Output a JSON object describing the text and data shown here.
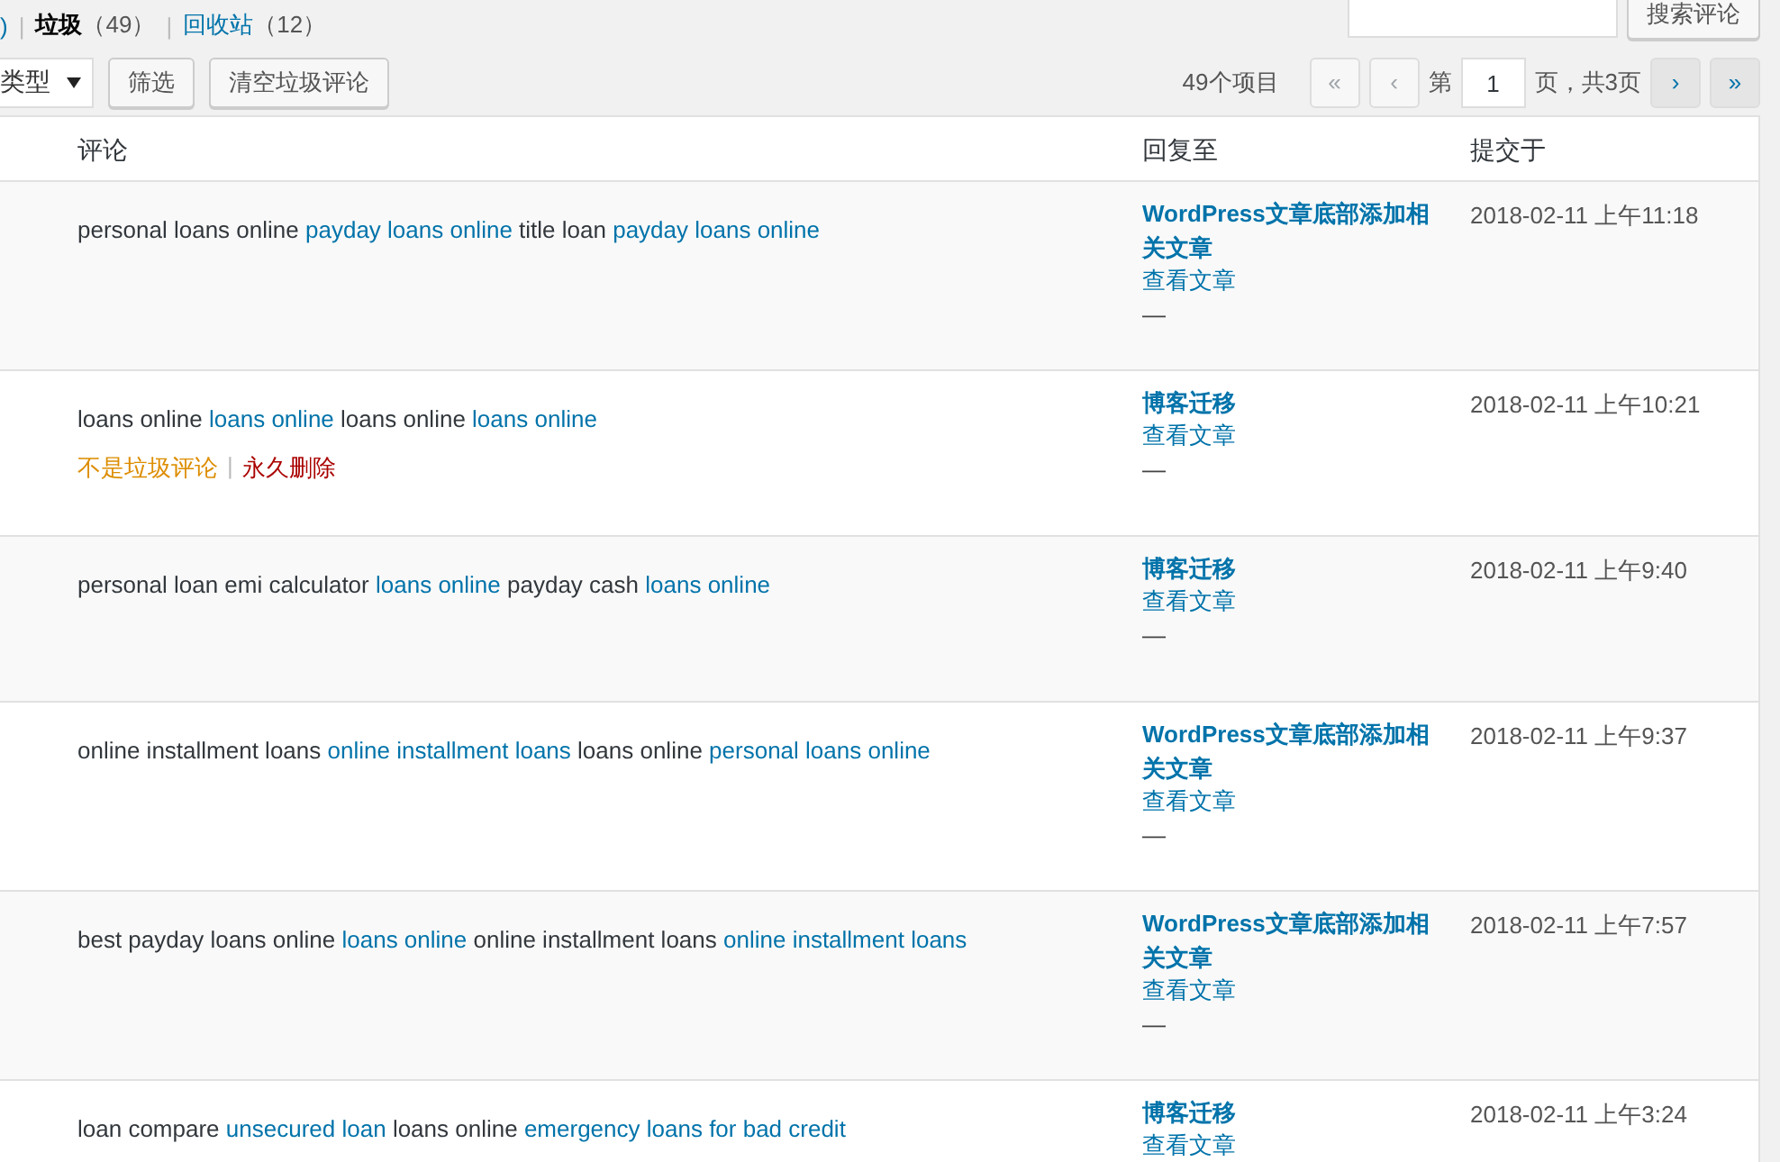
{
  "status_links": [
    {
      "label": ")",
      "selected": false
    },
    {
      "separator": "|",
      "label": "垃圾",
      "count": "（49）",
      "selected": true
    },
    {
      "separator": "|",
      "label": "回收站",
      "count": "（12）",
      "selected": false
    }
  ],
  "search": {
    "button": "搜索评论"
  },
  "filters": {
    "type_select": "类型",
    "filter_button": "筛选",
    "empty_button": "清空垃圾评论"
  },
  "pagination": {
    "count": "49个项目",
    "first": "«",
    "prev": "‹",
    "page_prefix": "第",
    "page": "1",
    "page_suffix": "页，共3页",
    "next": "›",
    "last": "»"
  },
  "table": {
    "columns": [
      "评论",
      "回复至",
      "提交于"
    ],
    "rows": [
      {
        "comment": [
          {
            "text": "personal loans online",
            "link": false
          },
          {
            "text": "payday loans online",
            "link": true
          },
          {
            "text": "title loan",
            "link": false
          },
          {
            "text": "payday loans online",
            "link": true
          }
        ],
        "actions": [],
        "reply_to": "WordPress文章底部添加相关文章",
        "view": "查看文章",
        "dash": "—",
        "date": "2018-02-11 上午11:18"
      },
      {
        "comment": [
          {
            "text": "loans online",
            "link": false
          },
          {
            "text": "loans online",
            "link": true
          },
          {
            "text": "loans online",
            "link": false
          },
          {
            "text": "loans online",
            "link": true
          }
        ],
        "actions": [
          {
            "label": "不是垃圾评论",
            "kind": "approve"
          },
          {
            "separator": "|",
            "label": "永久删除",
            "kind": "delete"
          }
        ],
        "reply_to": "博客迁移",
        "view": "查看文章",
        "dash": "—",
        "date": "2018-02-11 上午10:21"
      },
      {
        "comment": [
          {
            "text": "personal loan emi calculator",
            "link": false
          },
          {
            "text": "loans online",
            "link": true
          },
          {
            "text": "payday cash",
            "link": false
          },
          {
            "text": "loans online",
            "link": true
          }
        ],
        "actions": [],
        "reply_to": "博客迁移",
        "view": "查看文章",
        "dash": "—",
        "date": "2018-02-11 上午9:40"
      },
      {
        "comment": [
          {
            "text": "online installment loans",
            "link": false
          },
          {
            "text": "online installment loans",
            "link": true
          },
          {
            "text": "loans online",
            "link": false
          },
          {
            "text": "personal loans online",
            "link": true
          }
        ],
        "actions": [],
        "reply_to": "WordPress文章底部添加相关文章",
        "view": "查看文章",
        "dash": "—",
        "date": "2018-02-11 上午9:37"
      },
      {
        "comment": [
          {
            "text": "best payday loans online",
            "link": false
          },
          {
            "text": "loans online",
            "link": true
          },
          {
            "text": "online installment loans",
            "link": false
          },
          {
            "text": "online installment loans",
            "link": true
          }
        ],
        "actions": [],
        "reply_to": "WordPress文章底部添加相关文章",
        "view": "查看文章",
        "dash": "—",
        "date": "2018-02-11 上午7:57"
      },
      {
        "comment": [
          {
            "text": "loan compare",
            "link": false
          },
          {
            "text": "unsecured loan",
            "link": true
          },
          {
            "text": "loans online",
            "link": false
          },
          {
            "text": "emergency loans for bad credit",
            "link": true
          }
        ],
        "actions": [],
        "reply_to": "博客迁移",
        "view": "查看文章",
        "date": "2018-02-11 上午3:24"
      }
    ]
  }
}
